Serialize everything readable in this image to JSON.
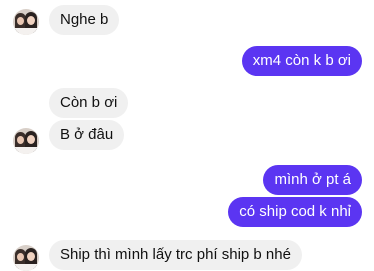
{
  "messages": [
    {
      "side": "in",
      "text": "Nghe b"
    },
    {
      "side": "out",
      "text": "xm4 còn k b ơi"
    },
    {
      "side": "in",
      "text": "Còn b ơi"
    },
    {
      "side": "in",
      "text": "B ở đâu"
    },
    {
      "side": "out",
      "text": "mình ở pt á"
    },
    {
      "side": "out",
      "text": "có ship cod k nhỉ"
    },
    {
      "side": "in",
      "text": "Ship thì mình lấy trc phí ship b nhé"
    }
  ],
  "colors": {
    "incoming_bubble": "#f0f0f0",
    "outgoing_bubble": "#5b35f2"
  }
}
